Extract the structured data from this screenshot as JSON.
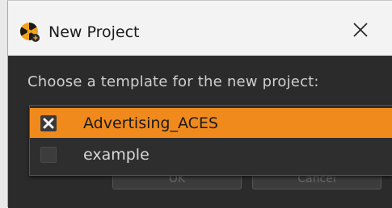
{
  "window": {
    "title": "New Project",
    "app_icon": "nuke-app-icon",
    "close_icon": "close-icon"
  },
  "dialog": {
    "prompt": "Choose a template for the new project:",
    "templates": [
      {
        "label": "Advertising_ACES",
        "checked": true,
        "selected": true
      },
      {
        "label": "example",
        "checked": false,
        "selected": false
      }
    ],
    "buttons": {
      "ok_label": "OK",
      "cancel_label": "Cancel"
    }
  },
  "colors": {
    "selection": "#f08a1c",
    "background": "#2b2b2b",
    "titlebar": "#f3f3f3"
  }
}
